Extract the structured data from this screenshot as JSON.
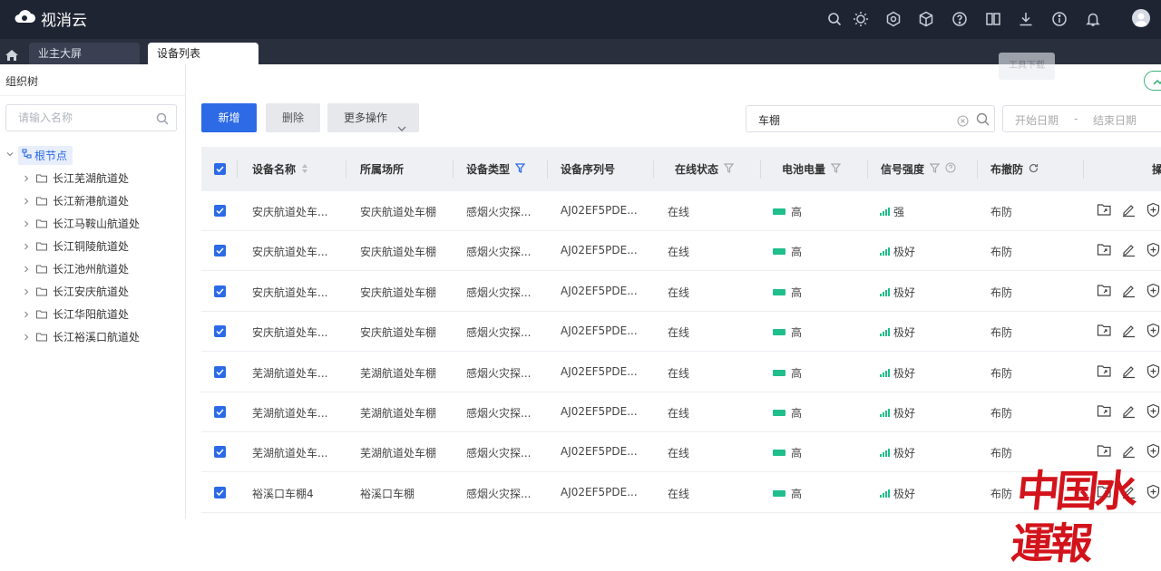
{
  "app": {
    "name": "视消云"
  },
  "topbar": {
    "tooltip": "工具下载",
    "icons": [
      "search-icon",
      "sun-icon",
      "settings-icon",
      "cube-icon",
      "help-icon",
      "book-icon",
      "download-icon",
      "info-icon",
      "bell-icon"
    ]
  },
  "tabs": [
    {
      "label": "业主大屏",
      "active": false
    },
    {
      "label": "设备列表",
      "active": true
    }
  ],
  "sidebar": {
    "title": "组织树",
    "search_placeholder": "请输入名称",
    "root": "根节点",
    "items": [
      "长江芜湖航道处",
      "长江新港航道处",
      "长江马鞍山航道处",
      "长江铜陵航道处",
      "长江池州航道处",
      "长江安庆航道处",
      "长江华阳航道处",
      "长江裕溪口航道处"
    ]
  },
  "toolbar": {
    "new_label": "新增",
    "delete_label": "删除",
    "more_label": "更多操作",
    "search_value": "车棚",
    "start_date_placeholder": "开始日期",
    "date_sep": "-",
    "end_date_placeholder": "结束日期"
  },
  "table": {
    "headers": {
      "name": "设备名称",
      "site": "所属场所",
      "type": "设备类型",
      "serial": "设备序列号",
      "online": "在线状态",
      "battery": "电池电量",
      "signal": "信号强度",
      "arm": "布撤防",
      "ops": "操"
    },
    "rows": [
      {
        "name": "安庆航道处车...",
        "site": "安庆航道处车棚",
        "type": "感烟火灾探...",
        "serial": "AJ02EF5PDE...",
        "online": "在线",
        "battery": "高",
        "signal": "强",
        "arm": "布防"
      },
      {
        "name": "安庆航道处车...",
        "site": "安庆航道处车棚",
        "type": "感烟火灾探...",
        "serial": "AJ02EF5PDE...",
        "online": "在线",
        "battery": "高",
        "signal": "极好",
        "arm": "布防"
      },
      {
        "name": "安庆航道处车...",
        "site": "安庆航道处车棚",
        "type": "感烟火灾探...",
        "serial": "AJ02EF5PDE...",
        "online": "在线",
        "battery": "高",
        "signal": "极好",
        "arm": "布防"
      },
      {
        "name": "安庆航道处车...",
        "site": "安庆航道处车棚",
        "type": "感烟火灾探...",
        "serial": "AJ02EF5PDE...",
        "online": "在线",
        "battery": "高",
        "signal": "极好",
        "arm": "布防"
      },
      {
        "name": "芜湖航道处车...",
        "site": "芜湖航道处车棚",
        "type": "感烟火灾探...",
        "serial": "AJ02EF5PDE...",
        "online": "在线",
        "battery": "高",
        "signal": "极好",
        "arm": "布防"
      },
      {
        "name": "芜湖航道处车...",
        "site": "芜湖航道处车棚",
        "type": "感烟火灾探...",
        "serial": "AJ02EF5PDE...",
        "online": "在线",
        "battery": "高",
        "signal": "极好",
        "arm": "布防"
      },
      {
        "name": "芜湖航道处车...",
        "site": "芜湖航道处车棚",
        "type": "感烟火灾探...",
        "serial": "AJ02EF5PDE...",
        "online": "在线",
        "battery": "高",
        "signal": "极好",
        "arm": "布防"
      },
      {
        "name": "裕溪口车棚4",
        "site": "裕溪口车棚",
        "type": "感烟火灾探...",
        "serial": "AJ02EF5PDE...",
        "online": "在线",
        "battery": "高",
        "signal": "极好",
        "arm": "布防"
      }
    ]
  },
  "watermark": "中国水運報",
  "colors": {
    "primary": "#2c6ae6",
    "topbar": "#1f2433",
    "battery": "#1fbe8a",
    "watermark": "#d3131b"
  }
}
